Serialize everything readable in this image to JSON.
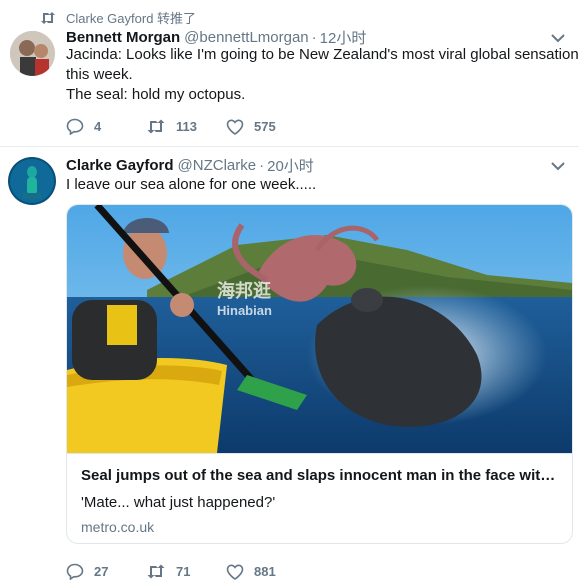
{
  "retweet_notice": {
    "text": "Clarke Gayford 转推了"
  },
  "tweets": [
    {
      "name": "Bennett Morgan",
      "handle": "@bennettLmorgan",
      "separator": "·",
      "time": "12小时",
      "lines": [
        "Jacinda: Looks like I'm going to be New Zealand's most viral global sensation",
        "this week.",
        "The seal: hold my octopus."
      ],
      "replies": "4",
      "retweets": "113",
      "likes": "575"
    },
    {
      "name": "Clarke Gayford",
      "handle": "@NZClarke",
      "separator": "·",
      "time": "20小时",
      "lines": [
        "I leave our sea alone for one week....."
      ],
      "card": {
        "watermark_cn": "海邦逛",
        "watermark_en": "Hinabian",
        "title": "Seal jumps out of the sea and slaps innocent man in the face with an ...",
        "description": "'Mate... what just happened?'",
        "domain": "metro.co.uk"
      },
      "replies": "27",
      "retweets": "71",
      "likes": "881"
    }
  ],
  "icons": {
    "retweet": "retweet-icon",
    "reply": "reply-icon",
    "like": "heart-icon",
    "chevron": "chevron-down-icon"
  },
  "colors": {
    "secondary_text": "#657786",
    "border": "#e1e8ed",
    "primary_text": "#14171a"
  }
}
